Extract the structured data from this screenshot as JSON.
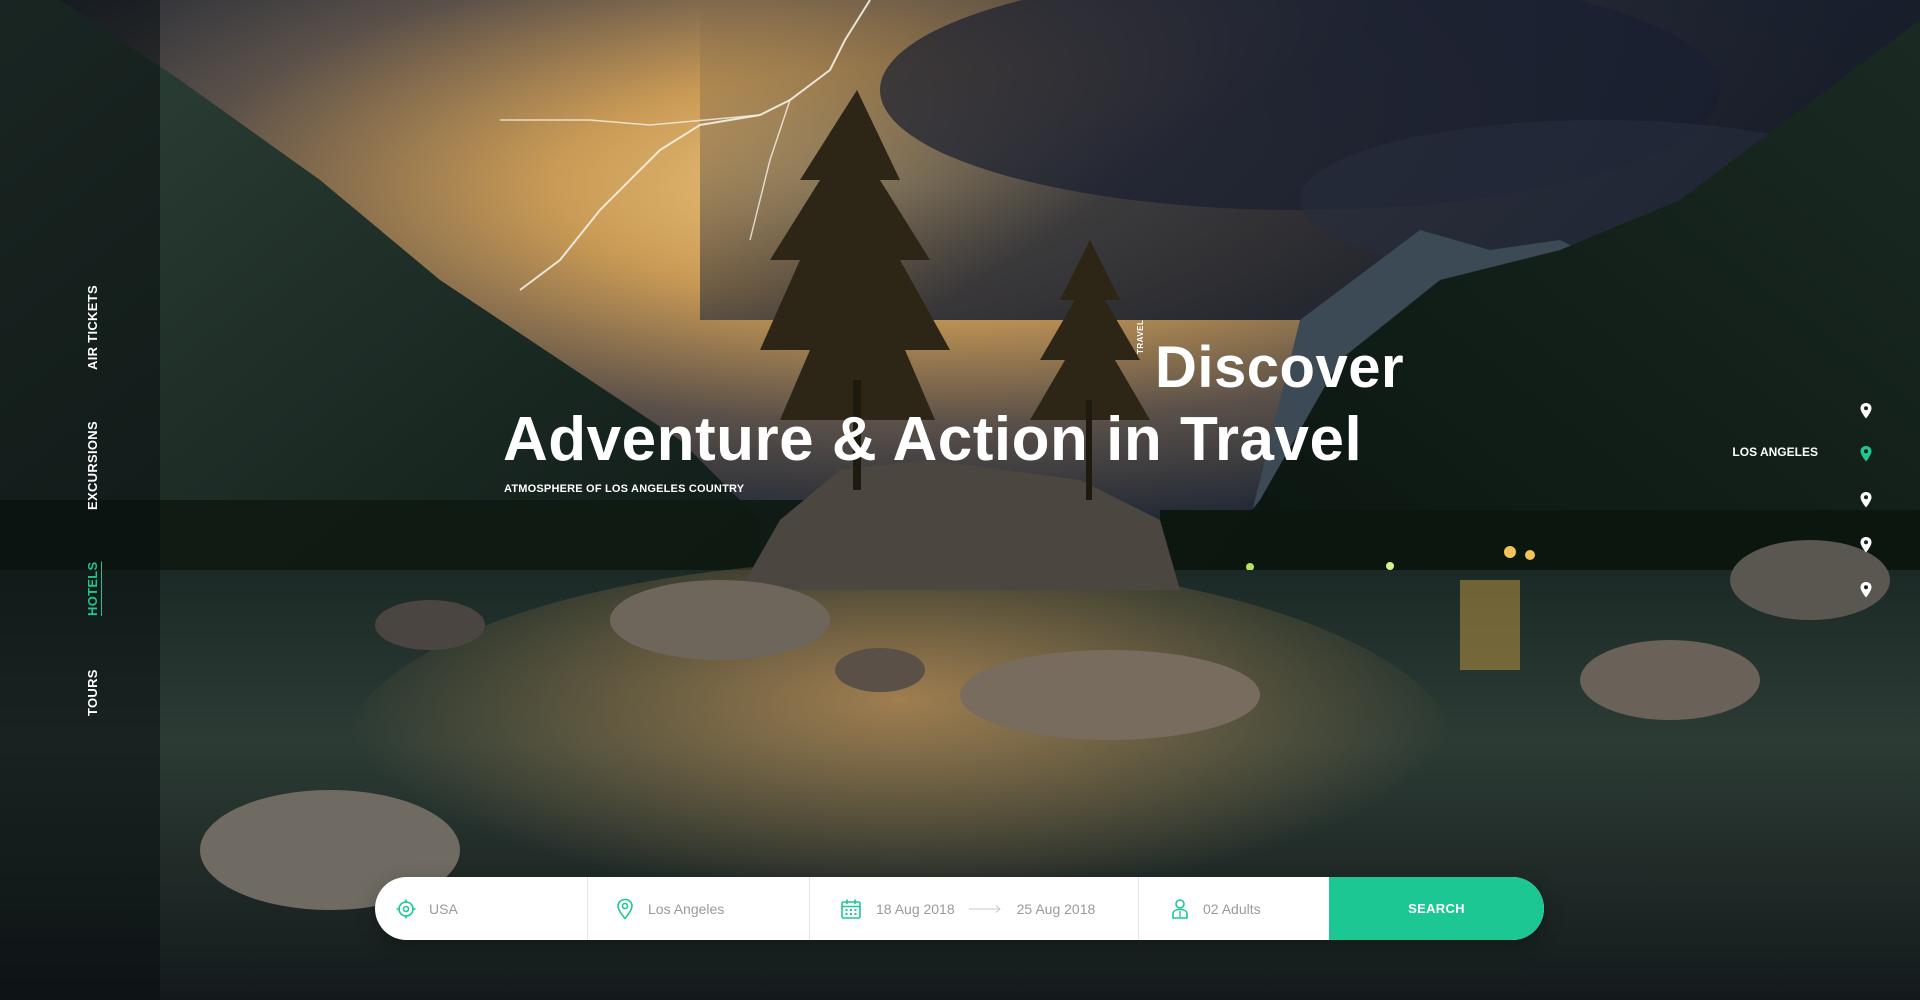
{
  "colors": {
    "accent": "#1cc793",
    "text_light": "#ffffff",
    "field_text": "#9a9a9a"
  },
  "side_nav": {
    "items": [
      {
        "label": "AIR TICKETS",
        "active": false
      },
      {
        "label": "EXCURSIONS",
        "active": false
      },
      {
        "label": "HOTELS",
        "active": true
      },
      {
        "label": "TOURS",
        "active": false
      }
    ]
  },
  "hero": {
    "kicker": "TRAVEL",
    "title_line1": "Discover",
    "title_line2": "Adventure & Action in Travel",
    "subtitle": "ATMOSPHERE OF LOS ANGELES COUNTRY"
  },
  "locations": {
    "active_label": "LOS ANGELES",
    "pin_icon": "map-pin-icon"
  },
  "search": {
    "country": {
      "value": "USA",
      "icon": "target-icon"
    },
    "city": {
      "value": "Los Angeles",
      "icon": "map-pin-icon"
    },
    "dates": {
      "start": "18 Aug 2018",
      "end": "25 Aug 2018",
      "icon": "calendar-icon"
    },
    "guests": {
      "value": "02 Adults",
      "icon": "person-icon"
    },
    "button_label": "SEARCH"
  }
}
